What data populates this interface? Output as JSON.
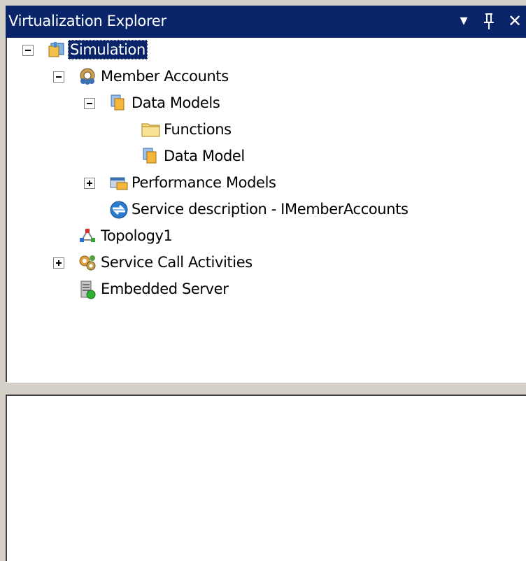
{
  "window": {
    "title": "Virtualization Explorer",
    "buttons": {
      "dropdown": "▾",
      "pin": "ᴨ",
      "close": "✕"
    }
  },
  "tree": {
    "nodes": [
      {
        "id": "simulation",
        "label": "Simulation",
        "expander": "minus",
        "icon": "solution-icon",
        "selected": true
      },
      {
        "id": "member-accounts",
        "label": "Member Accounts",
        "expander": "minus",
        "icon": "gear-people-icon"
      },
      {
        "id": "data-models",
        "label": "Data Models",
        "expander": "minus",
        "icon": "data-models-icon"
      },
      {
        "id": "functions",
        "label": "Functions",
        "icon": "folder-icon"
      },
      {
        "id": "data-model",
        "label": "Data Model",
        "icon": "data-model-icon"
      },
      {
        "id": "performance-models",
        "label": "Performance Models",
        "expander": "plus",
        "icon": "performance-models-icon"
      },
      {
        "id": "service-description",
        "label": "Service description - IMemberAccounts",
        "icon": "service-description-icon"
      },
      {
        "id": "topology1",
        "label": "Topology1",
        "icon": "topology-icon"
      },
      {
        "id": "service-call-activities",
        "label": "Service Call Activities",
        "expander": "plus",
        "icon": "activities-icon"
      },
      {
        "id": "embedded-server",
        "label": "Embedded Server",
        "icon": "server-icon"
      }
    ]
  },
  "colors": {
    "selection": "#0a246a",
    "titlebar": "#0a246a",
    "chrome": "#d4d0c8"
  }
}
